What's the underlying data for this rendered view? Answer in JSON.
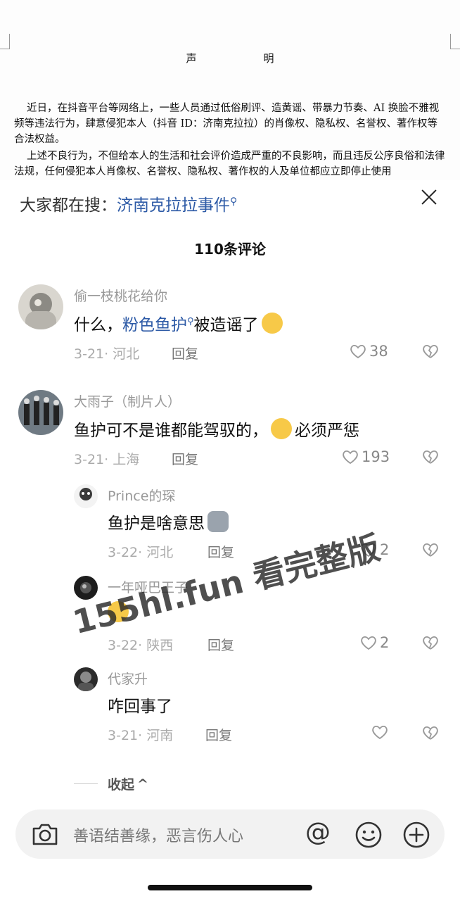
{
  "document": {
    "title": "声　明",
    "para1": "近日，在抖音平台等网络上，一些人员通过低俗刷评、造黄谣、带暴力节奏、AI 换脸不雅视频等违法行为，肆意侵犯本人（抖音 ID：济南克拉拉）的肖像权、隐私权、名誉权、著作权等合法权益。",
    "para2": "上述不良行为，不但给本人的生活和社会评价造成严重的不良影响，而且违反公序良俗和法律法规，任何侵犯本人肖像权、名誉权、隐私权、著作权的人及单位都应立即停止使用"
  },
  "sheet": {
    "trending_prefix": "大家都在搜：",
    "trending_keyword": "济南克拉拉事件",
    "comment_count": "110条评论"
  },
  "comments": [
    {
      "user": "偷一枝桃花给你",
      "text_before": "什么，",
      "link": "粉色鱼护",
      "text_after": "被造谣了",
      "date": "3-21",
      "location": "河北",
      "reply": "回复",
      "likes": "38"
    },
    {
      "user": "大雨子（制片人）",
      "text_before": "鱼护可不是谁都能驾驭的，",
      "text_after": "必须严惩",
      "date": "3-21",
      "location": "上海",
      "reply": "回复",
      "likes": "193"
    }
  ],
  "replies": [
    {
      "user": "Prince的琛",
      "text": "鱼护是啥意思",
      "date": "3-22",
      "location": "河北",
      "reply": "回复",
      "likes": "2"
    },
    {
      "user": "一年哑巴王子",
      "text": "",
      "date": "3-22",
      "location": "陕西",
      "reply": "回复",
      "likes": "2"
    },
    {
      "user": "代家升",
      "text": "咋回事了",
      "date": "3-21",
      "location": "河南",
      "reply": "回复",
      "likes": ""
    }
  ],
  "collapse_label": "收起",
  "watermark": "155hl.fun 看完整版",
  "input": {
    "placeholder": "善语结善缘，恶言伤人心",
    "at_symbol": "@"
  },
  "colors": {
    "link": "#2d5aa6",
    "meta": "#aaaaaa"
  }
}
